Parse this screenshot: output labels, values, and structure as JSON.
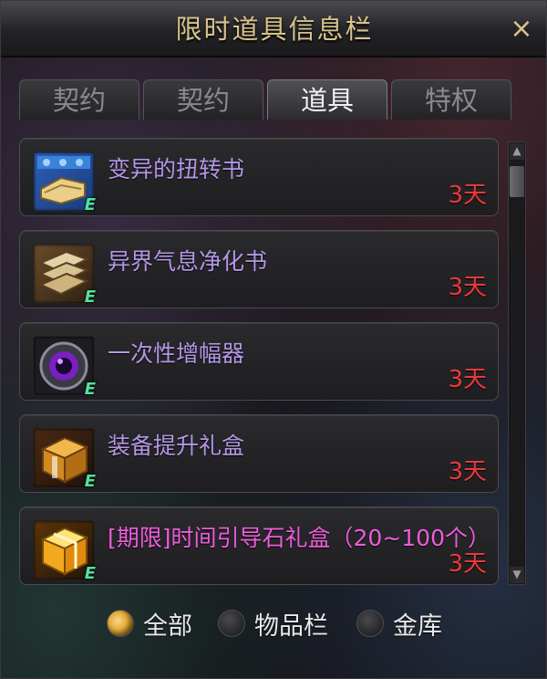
{
  "window": {
    "title": "限时道具信息栏",
    "close_label": "×"
  },
  "tabs": [
    {
      "label": "契约",
      "active": false
    },
    {
      "label": "契约",
      "active": false
    },
    {
      "label": "道具",
      "active": true
    },
    {
      "label": "特权",
      "active": false
    }
  ],
  "items": [
    {
      "name": "变异的扭转书",
      "time": "3天",
      "grade": "E",
      "icon": "scroll-book-icon",
      "name_color": "#b496e6"
    },
    {
      "name": "异界气息净化书",
      "time": "3天",
      "grade": "E",
      "icon": "purification-book-icon",
      "name_color": "#b496e6"
    },
    {
      "name": "一次性增幅器",
      "time": "3天",
      "grade": "E",
      "icon": "amplifier-orb-icon",
      "name_color": "#b496e6"
    },
    {
      "name": "装备提升礼盒",
      "time": "3天",
      "grade": "E",
      "icon": "gift-box-icon",
      "name_color": "#b496e6"
    },
    {
      "name": "[期限]时间引导石礼盒（20~100个）",
      "time": "3天",
      "grade": "E",
      "icon": "golden-gift-box-icon",
      "name_color": "#ee5ddc"
    }
  ],
  "filters": [
    {
      "label": "全部",
      "checked": true
    },
    {
      "label": "物品栏",
      "checked": false
    },
    {
      "label": "金库",
      "checked": false
    }
  ],
  "colors": {
    "title": "#d9c38a",
    "time": "#e8393b",
    "accent": "#e4a93b"
  }
}
